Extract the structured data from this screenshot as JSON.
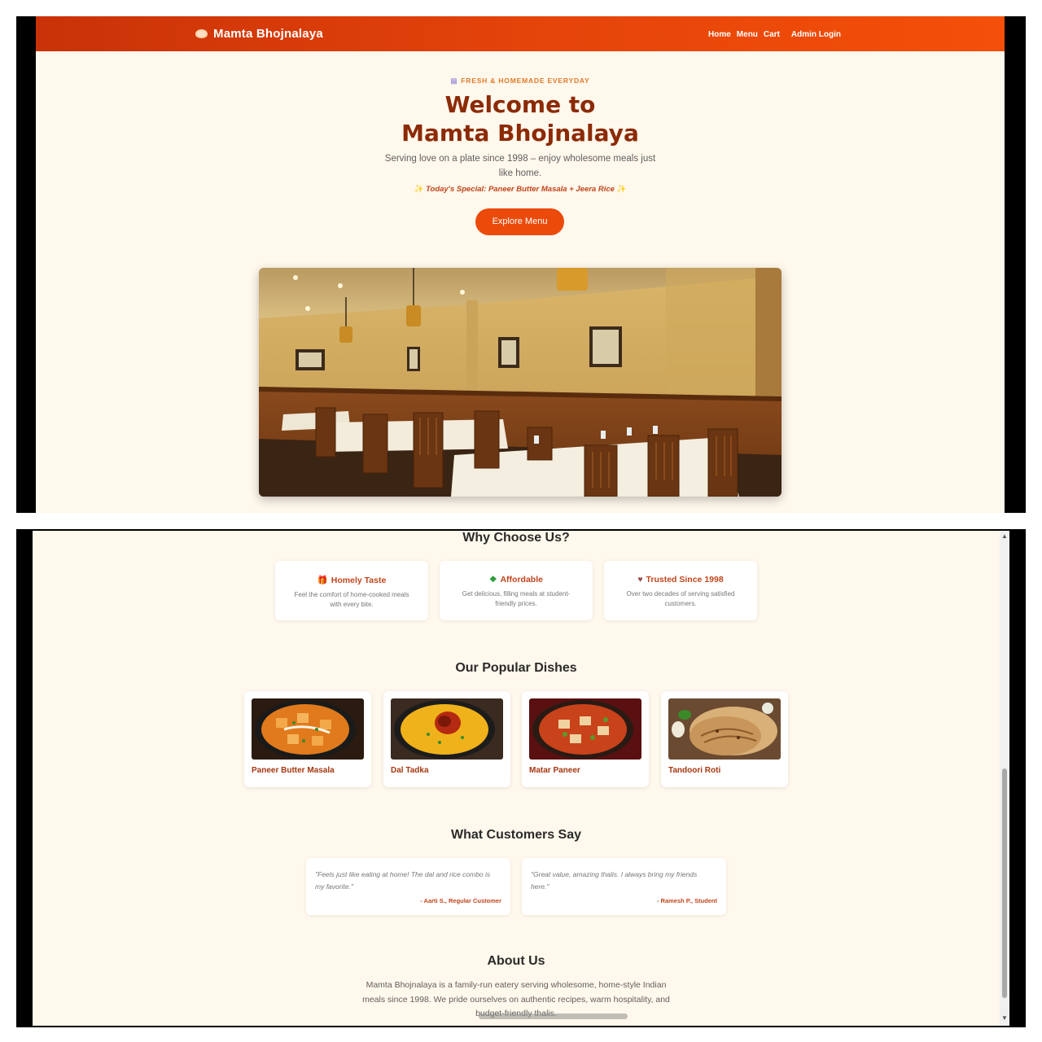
{
  "top": {
    "brand": {
      "name": "Mamta Bhojnalaya",
      "icon": "bowl-icon"
    },
    "nav": {
      "home": "Home",
      "menu": "Menu",
      "cart": "Cart",
      "admin_login": "Admin Login"
    },
    "hero": {
      "badge": "FRESH & HOMEMADE EVERYDAY",
      "badge_icon": "bowl-icon",
      "title_line1": "Welcome to",
      "title_line2": "Mamta Bhojnalaya",
      "subtitle": "Serving love on a plate since 1998 – enjoy wholesome meals just like home.",
      "special": "Today's Special: Paneer Butter Masala + Jeera Rice",
      "cta": "Explore Menu"
    }
  },
  "bottom": {
    "why": {
      "title": "Why Choose Us?",
      "features": [
        {
          "icon": "gift-icon",
          "title": "Homely Taste",
          "desc": "Feel the comfort of home-cooked meals with every bite."
        },
        {
          "icon": "money-icon",
          "title": "Affordable",
          "desc": "Get delicious, filling meals at student-friendly prices."
        },
        {
          "icon": "heart-icon",
          "title": "Trusted Since 1998",
          "desc": "Over two decades of serving satisfied customers."
        }
      ]
    },
    "dishes": {
      "title": "Our Popular Dishes",
      "items": [
        {
          "name": "Paneer Butter Masala"
        },
        {
          "name": "Dal Tadka"
        },
        {
          "name": "Matar Paneer"
        },
        {
          "name": "Tandoori Roti"
        }
      ]
    },
    "testimonials": {
      "title": "What Customers Say",
      "items": [
        {
          "quote": "\"Feels just like eating at home! The dal and rice combo is my favorite.\"",
          "author": "- Aarti S., Regular Customer"
        },
        {
          "quote": "\"Great value, amazing thalis. I always bring my friends here.\"",
          "author": "- Ramesh P., Student"
        }
      ]
    },
    "about": {
      "title": "About Us",
      "text": "Mamta Bhojnalaya is a family-run eatery serving wholesome, home-style Indian meals since 1998. We pride ourselves on authentic recipes, warm hospitality, and budget-friendly thalis."
    }
  },
  "colors": {
    "primary": "#e4430a",
    "heading": "#8c2a06",
    "accent": "#c0451b",
    "background": "#fff8ec"
  }
}
